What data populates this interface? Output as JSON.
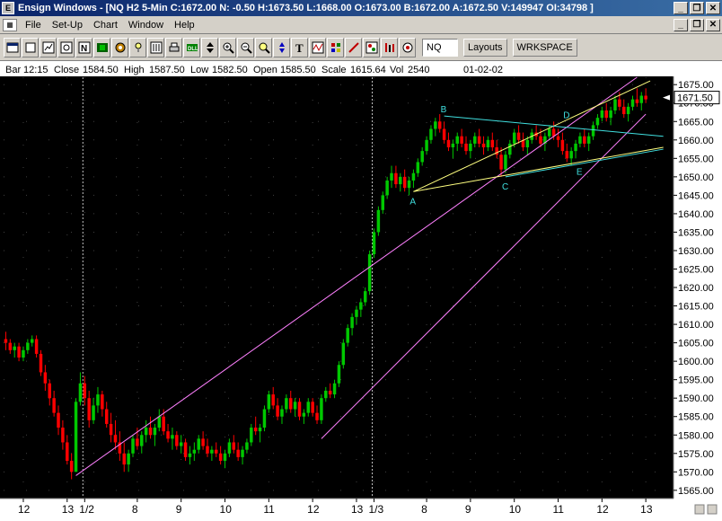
{
  "window": {
    "title": "Ensign Windows - [NQ H2 5-Min C:1672.00 N: -0.50 H:1673.50 L:1668.00 O:1673.00 B:1672.00 A:1672.50 V:149947 OI:34798 ]",
    "minimize": "_",
    "restore": "❐",
    "close": "✕"
  },
  "menu": {
    "items": [
      "File",
      "Set-Up",
      "Chart",
      "Window",
      "Help"
    ]
  },
  "toolbar": {
    "icons": [
      "window-icon",
      "blank-icon",
      "chart-icon",
      "ohlc-icon",
      "n-icon",
      "color-icon",
      "gear-icon",
      "light-icon",
      "bars-icon",
      "print-icon",
      "dll-icon",
      "updown-icon",
      "zoom-in-icon",
      "zoom-out-icon",
      "magic-icon",
      "scroll-icon",
      "text-icon",
      "wave-icon",
      "grid-icon",
      "pencil-icon",
      "tool-icon",
      "study-icon",
      "clock-icon"
    ],
    "symbol": "NQ",
    "layouts_label": "Layouts",
    "workspace_label": "WRKSPACE"
  },
  "info_bar": {
    "bar_label": "Bar",
    "bar_value": "12:15",
    "close_label": "Close",
    "close_value": "1584.50",
    "high_label": "High",
    "high_value": "1587.50",
    "low_label": "Low",
    "low_value": "1582.50",
    "open_label": "Open",
    "open_value": "1585.50",
    "scale_label": "Scale",
    "scale_value": "1615.64",
    "vol_label": "Vol",
    "vol_value": "2540",
    "date": "01-02-02"
  },
  "colors": {
    "background": "#000000",
    "up_bar": "#00c800",
    "down_bar": "#ff0000",
    "channel": "#ff80ff",
    "triangle": "#40e0e0",
    "wedge": "#ffff80",
    "axis_text": "#000000",
    "price_marker_bg": "#ffffff"
  },
  "chart_data": {
    "type": "candlestick",
    "instrument": "NQ H2 5-Min",
    "y_ticks": [
      1675,
      1670,
      1665,
      1660,
      1655,
      1650,
      1645,
      1640,
      1635,
      1630,
      1625,
      1620,
      1615,
      1610,
      1605,
      1600,
      1595,
      1590,
      1585,
      1580,
      1575,
      1570,
      1565
    ],
    "y_tick_labels": [
      "1675.00",
      "1670.00",
      "1665.00",
      "1660.00",
      "1655.00",
      "1650.00",
      "1645.00",
      "1640.00",
      "1635.00",
      "1630.00",
      "1625.00",
      "1620.00",
      "1615.00",
      "1610.00",
      "1605.00",
      "1600.00",
      "1595.00",
      "1590.00",
      "1585.00",
      "1580.00",
      "1575.00",
      "1570.00",
      "1565.00"
    ],
    "ylim": [
      1563.5,
      1677
    ],
    "x_tick_labels": [
      "12",
      "13",
      "1/2",
      "8",
      "9",
      "10",
      "11",
      "12",
      "13",
      "1/3",
      "8",
      "9",
      "10",
      "11",
      "12",
      "13"
    ],
    "x_tick_bars": [
      4,
      14,
      18,
      30,
      40,
      50,
      60,
      70,
      80,
      84,
      96,
      106,
      116,
      126,
      136,
      146
    ],
    "bar_count": 152,
    "last_price": "1671.50",
    "last_price_value": 1671.5,
    "pattern_labels": [
      "A",
      "B",
      "C",
      "D",
      "E"
    ],
    "pattern_points": [
      {
        "bar": 93,
        "price": 1646
      },
      {
        "bar": 100,
        "price": 1666.5
      },
      {
        "bar": 114,
        "price": 1650
      },
      {
        "bar": 128,
        "price": 1665
      },
      {
        "bar": 131,
        "price": 1654
      }
    ],
    "ohlc": [
      [
        1606,
        1608,
        1603,
        1605
      ],
      [
        1605,
        1606,
        1602,
        1603
      ],
      [
        1603,
        1605,
        1601,
        1604
      ],
      [
        1604,
        1605,
        1600,
        1601
      ],
      [
        1601,
        1604,
        1600,
        1603
      ],
      [
        1603,
        1606,
        1602,
        1605
      ],
      [
        1605,
        1607,
        1604,
        1606
      ],
      [
        1606,
        1607,
        1601,
        1602
      ],
      [
        1602,
        1603,
        1596,
        1597
      ],
      [
        1597,
        1599,
        1592,
        1594
      ],
      [
        1594,
        1595,
        1588,
        1590
      ],
      [
        1590,
        1592,
        1585,
        1586
      ],
      [
        1586,
        1588,
        1580,
        1582
      ],
      [
        1582,
        1584,
        1576,
        1578
      ],
      [
        1578,
        1580,
        1572,
        1573
      ],
      [
        1573,
        1575,
        1568,
        1570
      ],
      [
        1570,
        1590,
        1570,
        1589
      ],
      [
        1589,
        1597,
        1588,
        1594
      ],
      [
        1594,
        1596,
        1588,
        1590
      ],
      [
        1590,
        1592,
        1582,
        1584
      ],
      [
        1584,
        1590,
        1583,
        1588
      ],
      [
        1588,
        1593,
        1586,
        1591
      ],
      [
        1591,
        1592,
        1585,
        1587
      ],
      [
        1587,
        1589,
        1582,
        1583
      ],
      [
        1583,
        1586,
        1578,
        1580
      ],
      [
        1580,
        1584,
        1576,
        1578
      ],
      [
        1578,
        1581,
        1573,
        1575
      ],
      [
        1575,
        1578,
        1570,
        1572
      ],
      [
        1572,
        1576,
        1570,
        1575
      ],
      [
        1575,
        1580,
        1574,
        1579
      ],
      [
        1579,
        1582,
        1576,
        1577
      ],
      [
        1577,
        1581,
        1575,
        1580
      ],
      [
        1580,
        1584,
        1578,
        1582
      ],
      [
        1582,
        1585,
        1579,
        1580
      ],
      [
        1580,
        1583,
        1577,
        1582
      ],
      [
        1582,
        1587,
        1581,
        1585
      ],
      [
        1585,
        1587,
        1580,
        1581
      ],
      [
        1581,
        1583,
        1578,
        1579
      ],
      [
        1579,
        1582,
        1576,
        1580
      ],
      [
        1580,
        1581,
        1576,
        1577
      ],
      [
        1577,
        1580,
        1575,
        1578
      ],
      [
        1578,
        1579,
        1573,
        1574
      ],
      [
        1574,
        1577,
        1572,
        1575
      ],
      [
        1575,
        1578,
        1573,
        1576
      ],
      [
        1576,
        1580,
        1575,
        1579
      ],
      [
        1579,
        1581,
        1576,
        1577
      ],
      [
        1577,
        1579,
        1574,
        1575
      ],
      [
        1575,
        1577,
        1573,
        1576
      ],
      [
        1576,
        1578,
        1574,
        1575
      ],
      [
        1575,
        1577,
        1572,
        1573
      ],
      [
        1573,
        1576,
        1571,
        1575
      ],
      [
        1575,
        1579,
        1574,
        1578
      ],
      [
        1578,
        1580,
        1575,
        1576
      ],
      [
        1576,
        1578,
        1573,
        1574
      ],
      [
        1574,
        1577,
        1572,
        1576
      ],
      [
        1576,
        1579,
        1575,
        1578
      ],
      [
        1578,
        1583,
        1577,
        1582
      ],
      [
        1582,
        1585,
        1580,
        1581
      ],
      [
        1581,
        1583,
        1578,
        1582
      ],
      [
        1582,
        1588,
        1581,
        1587
      ],
      [
        1587,
        1592,
        1586,
        1591
      ],
      [
        1591,
        1593,
        1587,
        1588
      ],
      [
        1588,
        1590,
        1584,
        1585
      ],
      [
        1585,
        1588,
        1583,
        1587
      ],
      [
        1587,
        1591,
        1586,
        1590
      ],
      [
        1590,
        1592,
        1586,
        1587
      ],
      [
        1587,
        1590,
        1585,
        1589
      ],
      [
        1589,
        1590,
        1584,
        1585
      ],
      [
        1585,
        1587,
        1583,
        1586
      ],
      [
        1586,
        1590,
        1585,
        1589
      ],
      [
        1589,
        1590,
        1585,
        1586
      ],
      [
        1586,
        1588,
        1583,
        1584
      ],
      [
        1584,
        1591,
        1583,
        1590
      ],
      [
        1590,
        1593,
        1589,
        1592
      ],
      [
        1592,
        1594,
        1590,
        1591
      ],
      [
        1591,
        1595,
        1590,
        1594
      ],
      [
        1594,
        1600,
        1593,
        1599
      ],
      [
        1599,
        1606,
        1598,
        1605
      ],
      [
        1605,
        1610,
        1604,
        1609
      ],
      [
        1609,
        1613,
        1607,
        1612
      ],
      [
        1612,
        1615,
        1610,
        1614
      ],
      [
        1614,
        1617,
        1612,
        1616
      ],
      [
        1616,
        1620,
        1615,
        1619
      ],
      [
        1619,
        1630,
        1618,
        1629
      ],
      [
        1629,
        1636,
        1628,
        1635
      ],
      [
        1635,
        1642,
        1634,
        1641
      ],
      [
        1641,
        1646,
        1640,
        1645
      ],
      [
        1645,
        1650,
        1644,
        1649
      ],
      [
        1649,
        1653,
        1647,
        1651
      ],
      [
        1651,
        1653,
        1647,
        1648
      ],
      [
        1648,
        1651,
        1646,
        1650
      ],
      [
        1650,
        1652,
        1646,
        1647
      ],
      [
        1647,
        1650,
        1645,
        1649
      ],
      [
        1649,
        1652,
        1647,
        1651
      ],
      [
        1651,
        1655,
        1650,
        1654
      ],
      [
        1654,
        1658,
        1653,
        1657
      ],
      [
        1657,
        1661,
        1656,
        1660
      ],
      [
        1660,
        1664,
        1659,
        1663
      ],
      [
        1663,
        1666,
        1661,
        1665
      ],
      [
        1665,
        1667,
        1662,
        1663
      ],
      [
        1663,
        1665,
        1659,
        1660
      ],
      [
        1660,
        1662,
        1657,
        1658
      ],
      [
        1658,
        1660,
        1655,
        1659
      ],
      [
        1659,
        1662,
        1657,
        1661
      ],
      [
        1661,
        1663,
        1658,
        1659
      ],
      [
        1659,
        1661,
        1656,
        1657
      ],
      [
        1657,
        1660,
        1655,
        1659
      ],
      [
        1659,
        1662,
        1658,
        1661
      ],
      [
        1661,
        1663,
        1658,
        1659
      ],
      [
        1659,
        1661,
        1656,
        1658
      ],
      [
        1658,
        1661,
        1657,
        1660
      ],
      [
        1660,
        1662,
        1657,
        1658
      ],
      [
        1658,
        1660,
        1655,
        1656
      ],
      [
        1656,
        1658,
        1650,
        1652
      ],
      [
        1652,
        1657,
        1651,
        1656
      ],
      [
        1656,
        1660,
        1655,
        1659
      ],
      [
        1659,
        1663,
        1658,
        1662
      ],
      [
        1662,
        1664,
        1659,
        1660
      ],
      [
        1660,
        1662,
        1657,
        1658
      ],
      [
        1658,
        1661,
        1656,
        1660
      ],
      [
        1660,
        1663,
        1659,
        1662
      ],
      [
        1662,
        1664,
        1660,
        1661
      ],
      [
        1661,
        1663,
        1658,
        1659
      ],
      [
        1659,
        1662,
        1657,
        1661
      ],
      [
        1661,
        1664,
        1660,
        1663
      ],
      [
        1663,
        1665,
        1660,
        1661
      ],
      [
        1661,
        1663,
        1658,
        1660
      ],
      [
        1660,
        1662,
        1656,
        1657
      ],
      [
        1657,
        1659,
        1654,
        1655
      ],
      [
        1655,
        1658,
        1653,
        1657
      ],
      [
        1657,
        1660,
        1655,
        1659
      ],
      [
        1659,
        1662,
        1658,
        1661
      ],
      [
        1661,
        1663,
        1658,
        1659
      ],
      [
        1659,
        1662,
        1657,
        1661
      ],
      [
        1661,
        1665,
        1660,
        1664
      ],
      [
        1664,
        1667,
        1663,
        1666
      ],
      [
        1666,
        1669,
        1665,
        1668
      ],
      [
        1668,
        1670,
        1665,
        1666
      ],
      [
        1666,
        1669,
        1664,
        1668
      ],
      [
        1668,
        1672,
        1667,
        1671
      ],
      [
        1671,
        1673,
        1668,
        1669
      ],
      [
        1669,
        1671,
        1666,
        1667
      ],
      [
        1667,
        1670,
        1665,
        1669
      ],
      [
        1669,
        1672,
        1668,
        1671
      ],
      [
        1671,
        1674,
        1669,
        1670
      ],
      [
        1670,
        1673,
        1668,
        1672
      ],
      [
        1672,
        1674,
        1670,
        1671
      ]
    ],
    "lines": [
      {
        "kind": "channel",
        "from": {
          "bar": 16,
          "price": 1569
        },
        "to": {
          "bar": 144,
          "price": 1677
        }
      },
      {
        "kind": "channel",
        "from": {
          "bar": 72,
          "price": 1579
        },
        "to": {
          "bar": 146,
          "price": 1667
        }
      },
      {
        "kind": "wedge",
        "from": {
          "bar": 93,
          "price": 1646
        },
        "to": {
          "bar": 147,
          "price": 1676
        }
      },
      {
        "kind": "wedge",
        "from": {
          "bar": 93,
          "price": 1646
        },
        "to": {
          "bar": 150,
          "price": 1658
        }
      },
      {
        "kind": "triangle",
        "from": {
          "bar": 100,
          "price": 1666.5
        },
        "to": {
          "bar": 150,
          "price": 1661
        }
      },
      {
        "kind": "triangle",
        "from": {
          "bar": 114,
          "price": 1650
        },
        "to": {
          "bar": 150,
          "price": 1657.5
        }
      }
    ],
    "grid": true
  }
}
